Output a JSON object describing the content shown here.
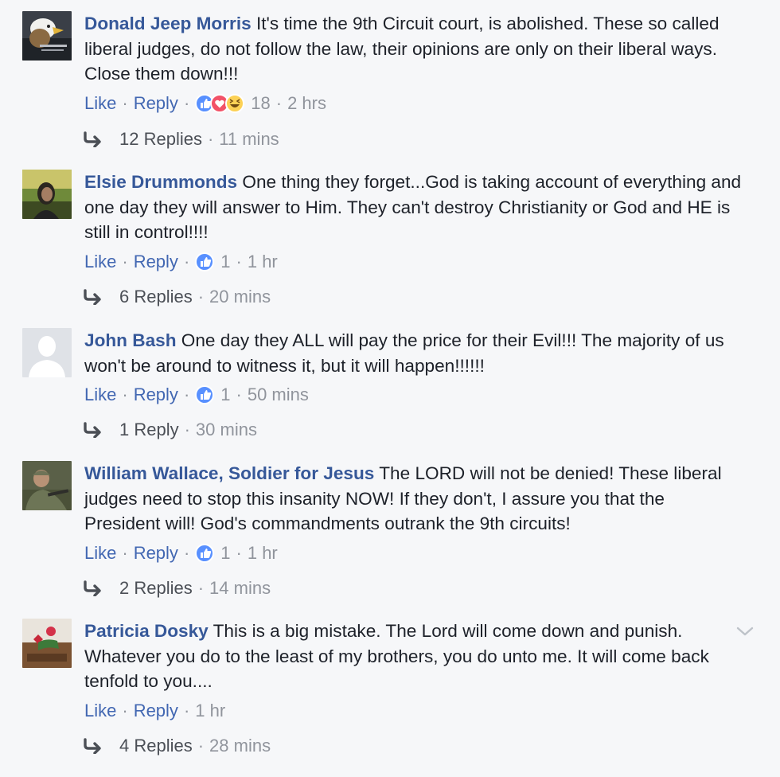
{
  "comments": [
    {
      "author": "Donald Jeep Morris",
      "text": "It's time the 9th Circuit court, is abolished. These so called liberal judges, do not follow the law, their opinions are only on their liberal ways. Close them down!!!",
      "like_label": "Like",
      "reply_label": "Reply",
      "reactions": [
        "like",
        "love",
        "haha"
      ],
      "reaction_count": "18",
      "time": "2 hrs",
      "replies_label": "12 Replies",
      "replies_time": "11 mins"
    },
    {
      "author": "Elsie Drummonds",
      "text": "One thing they forget...God is taking account of everything and one day they will answer to Him. They can't destroy Christianity or God and HE is still in control!!!!",
      "like_label": "Like",
      "reply_label": "Reply",
      "reactions": [
        "like"
      ],
      "reaction_count": "1",
      "time": "1 hr",
      "replies_label": "6 Replies",
      "replies_time": "20 mins"
    },
    {
      "author": "John Bash",
      "text": "One day they ALL will pay the price for their Evil!!! The majority of us won't be around to witness it, but it will happen!!!!!!",
      "like_label": "Like",
      "reply_label": "Reply",
      "reactions": [
        "like"
      ],
      "reaction_count": "1",
      "time": "50 mins",
      "replies_label": "1 Reply",
      "replies_time": "30 mins"
    },
    {
      "author": "William Wallace, Soldier for Jesus",
      "text": "The LORD will not be denied! These liberal judges need to stop this insanity NOW! If they don't, I assure you that the President will! God's commandments outrank the 9th circuits!",
      "like_label": "Like",
      "reply_label": "Reply",
      "reactions": [
        "like"
      ],
      "reaction_count": "1",
      "time": "1 hr",
      "replies_label": "2 Replies",
      "replies_time": "14 mins"
    },
    {
      "author": "Patricia Dosky",
      "text": "This is a big mistake. The Lord will come down and punish. Whatever you do to the least of my brothers, you do unto me. It will come back tenfold to you....",
      "like_label": "Like",
      "reply_label": "Reply",
      "time": "1 hr",
      "replies_label": "4 Replies",
      "replies_time": "28 mins"
    }
  ],
  "colors": {
    "author": "#365899",
    "action_link": "#4267b2",
    "meta": "#90949c",
    "background": "#f6f7f9",
    "like": "#5890ff",
    "love": "#f25268",
    "haha": "#fcd155"
  }
}
